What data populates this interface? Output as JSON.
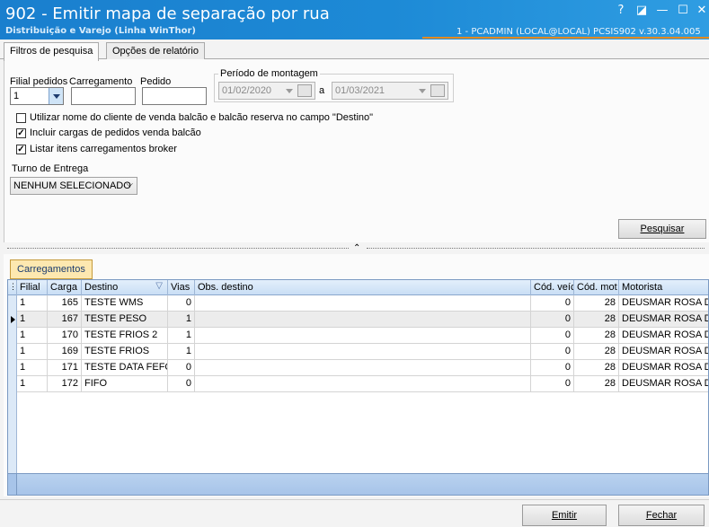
{
  "window": {
    "title": "902 - Emitir mapa de separação por rua",
    "subtitle": "Distribuição e Varejo (Linha WinThor)",
    "user_info": "1 - PCADMIN (LOCAL@LOCAL)   PCSIS902  v.30.3.04.005",
    "controls": [
      "?",
      "◪",
      "—",
      "☐",
      "✕"
    ]
  },
  "tabs": [
    {
      "label": "Filtros de pesquisa",
      "active": true
    },
    {
      "label": "Opções de relatório",
      "active": false
    }
  ],
  "filters": {
    "filial_label": "Filial pedidos",
    "filial_value": "1",
    "carregamento_label": "Carregamento",
    "carregamento_value": "",
    "pedido_label": "Pedido",
    "pedido_value": "",
    "periodo_label": "Período de montagem",
    "date_from": "01/02/2020",
    "date_sep": "a",
    "date_to": "01/03/2021",
    "checkboxes": [
      {
        "label": "Utilizar nome do cliente de venda balcão e balcão reserva no campo \"Destino\"",
        "checked": false
      },
      {
        "label": "Incluir cargas de pedidos venda balcão",
        "checked": true
      },
      {
        "label": "Listar itens carregamentos broker",
        "checked": true
      }
    ],
    "turno_label": "Turno de Entrega",
    "turno_value": "NENHUM SELECIONADO",
    "search_button": "Pesquisar"
  },
  "grid": {
    "tab_label": "Carregamentos",
    "columns": [
      "Filial",
      "Carga",
      "Destino",
      "Vias",
      "Obs. destino",
      "Cód. veíc",
      "Cód. mot",
      "Motorista"
    ],
    "rows": [
      {
        "filial": "1",
        "carga": "165",
        "destino": "TESTE WMS",
        "vias": "0",
        "obs": "",
        "veic": "0",
        "mot": "28",
        "motorista": "DEUSMAR ROSA DI"
      },
      {
        "filial": "1",
        "carga": "167",
        "destino": "TESTE PESO",
        "vias": "1",
        "obs": "",
        "veic": "0",
        "mot": "28",
        "motorista": "DEUSMAR ROSA DI"
      },
      {
        "filial": "1",
        "carga": "170",
        "destino": "TESTE FRIOS 2",
        "vias": "1",
        "obs": "",
        "veic": "0",
        "mot": "28",
        "motorista": "DEUSMAR ROSA DI"
      },
      {
        "filial": "1",
        "carga": "169",
        "destino": "TESTE FRIOS",
        "vias": "1",
        "obs": "",
        "veic": "0",
        "mot": "28",
        "motorista": "DEUSMAR ROSA DI"
      },
      {
        "filial": "1",
        "carga": "171",
        "destino": "TESTE DATA FEFO",
        "vias": "0",
        "obs": "",
        "veic": "0",
        "mot": "28",
        "motorista": "DEUSMAR ROSA DI"
      },
      {
        "filial": "1",
        "carga": "172",
        "destino": "FIFO",
        "vias": "0",
        "obs": "",
        "veic": "0",
        "mot": "28",
        "motorista": "DEUSMAR ROSA DI"
      }
    ],
    "selected_row": 1
  },
  "footer": {
    "emitir": "Emitir",
    "fechar": "Fechar"
  },
  "colors": {
    "titlebar": "#1d8ad6",
    "accent_orange": "#e58a1f",
    "grid_tab": "#fde8b0"
  }
}
